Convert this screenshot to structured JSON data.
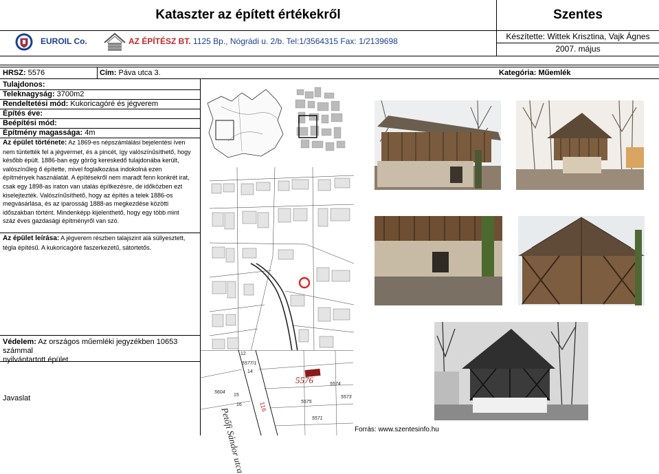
{
  "header": {
    "title": "Kataszter az épített értékekről",
    "city": "Szentes",
    "company1": "EUROIL Co.",
    "company2_name": "AZ ÉPÍTÉSZ BT.",
    "company2_addr": "1125 Bp., Nógrádi u. 2/b. Tel:1/3564315 Fax: 1/2139698",
    "author": "Készítette: Wittek Krisztina, Vajk Ágnes",
    "date": "2007. május"
  },
  "record": {
    "hrsz_label": "HRSZ:",
    "hrsz_value": "5576",
    "cim_label": "Cím:",
    "cim_value": "Páva utca 3.",
    "kategoria_label": "Kategória:",
    "kategoria_value": "Műemlék"
  },
  "fields": {
    "tulajdonos_label": "Tulajdonos:",
    "teleknagysag_label": "Teleknagyság:",
    "teleknagysag_value": "3700m2",
    "rendeltetes_label": "Rendeltetési mód:",
    "rendeltetes_value": "Kukoricagóré és jégverem",
    "epites_eve_label": "Építés éve:",
    "beepitesi_label": "Beépítési mód:",
    "magassag_label": "Építmény magassága:",
    "magassag_value": "4m",
    "tortenete_label": "Az épület története:",
    "tortenete_lines": [
      "Az 1869-es népszámlálási bejelentési íven",
      "nem tüntették fel a jégvermet, és a pincét, így valószínűsíthető, hogy",
      "később épült. 1886-ban egy görög kereskedő tulajdonába került,",
      "valószínűleg ő építette, mivel foglalkozása indokolná ezen",
      "építmények használatát. A építésekről nem maradt fenn konkrét irat,",
      "csak egy 1898-as iraton van utalás építkezésre, de időközben ezt",
      "kiselejtezték. Valószínűsíthető, hogy az építés a telek 1886-os",
      "megvásárlása, és az iparosság 1888-as megkezdése közötti",
      "időszakban történt. Mindenképp kijelenthető, hogy egy több mint",
      "száz éves gazdasági építményről van szó."
    ],
    "leiras_label": "Az épület leírása:",
    "leiras_lines": [
      "A jégverem részben talajszint alá süllyesztett,",
      "tégla építésű. A kukoricagóré faszerkezetű, sátortetős."
    ],
    "vedelem_label": "Védelem:",
    "vedelem_lines": [
      "Az országos műemléki jegyzékben 10653 számmal",
      "nyilvántartott épület."
    ],
    "javaslat_label": "Javaslat"
  },
  "map": {
    "lot_number": "5576",
    "street_name": "Petőfi Sándor utca",
    "labels": [
      "5577/1",
      "5574",
      "5573",
      "5575",
      "5571",
      "5604",
      "116",
      "12",
      "14",
      "15",
      "16"
    ]
  },
  "source": "Forrás: www.szentesinfo.hu",
  "colors": {
    "euroil_blue": "#1b3f8f",
    "euroil_red": "#c0282d",
    "lot_red": "#8b1a1a",
    "map_red": "#e02020"
  }
}
